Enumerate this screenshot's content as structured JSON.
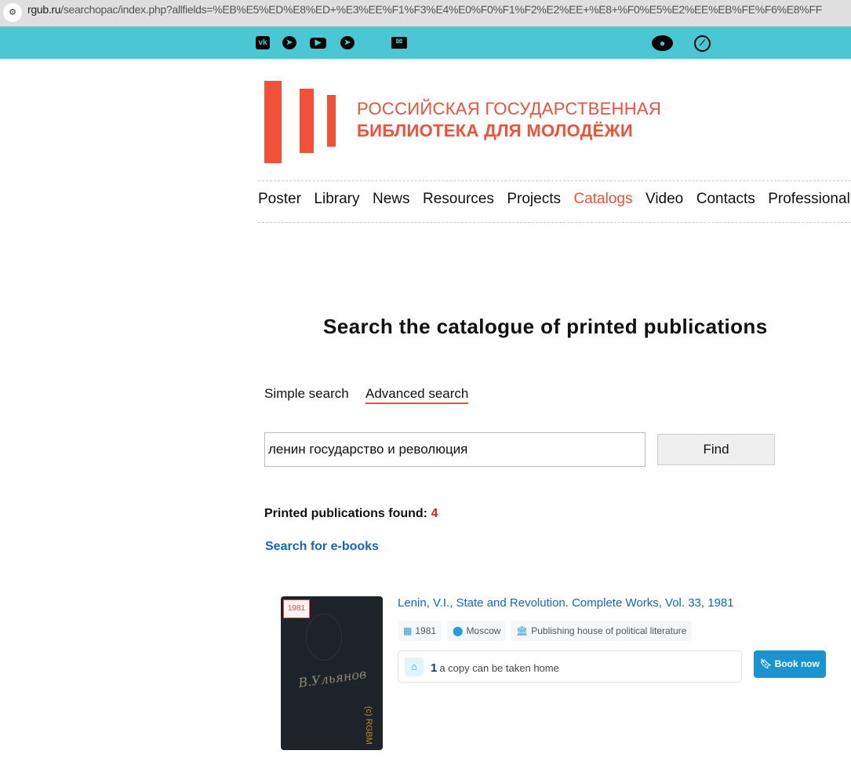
{
  "browser": {
    "url_host": "rgub.ru",
    "url_path": "/searchopac/index.php?allfields=%EB%E5%ED%E8%ED+%E3%EE%F1%F3%E4%E0%F0%F1%F2%E2%EE+%E8+%F0%E5%E2%EE%EB%FE%F6%E8%FF"
  },
  "topbar": {
    "icons": [
      "vk-icon",
      "telegram-icon",
      "youtube-icon",
      "telegram-icon",
      "mail-icon",
      "eye-icon",
      "compass-icon"
    ]
  },
  "logo": {
    "line1": "РОССИЙСКАЯ ГОСУДАРСТВЕННАЯ",
    "line2": "БИБЛИОТЕКА ДЛЯ МОЛОДЁЖИ",
    "color": "#f05138"
  },
  "nav": [
    "Poster",
    "Library",
    "News",
    "Resources",
    "Projects",
    "Catalogs",
    "Video",
    "Contacts",
    "Professional"
  ],
  "nav_active": "Catalogs",
  "page": {
    "title": "Search the catalogue of printed publications",
    "tabs": [
      "Simple search",
      "Advanced search"
    ],
    "active_tab": "Advanced search",
    "search_value": "ленин государство и революция",
    "find_label": "Find",
    "found_label": "Printed publications found:",
    "found_count": "4",
    "ebooks_link": "Search for e-books"
  },
  "results": [
    {
      "cover_year": "1981",
      "cover_watermark": "(c) RGBM",
      "title": "Lenin, V.I., State and Revolution. Complete Works, Vol. 33, 1981",
      "year": "1981",
      "city": "Moscow",
      "publisher": "Publishing house of political literature",
      "copies_count": "1",
      "copies_text": "a copy can be taken home",
      "book_label": "Book now"
    }
  ]
}
